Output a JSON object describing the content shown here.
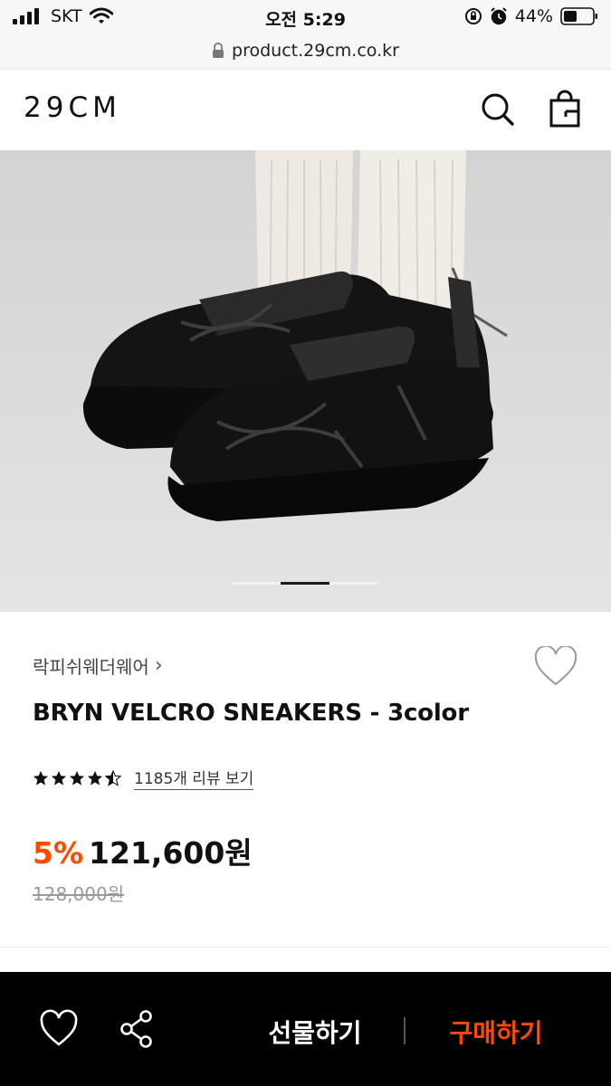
{
  "status_bar": {
    "carrier": "SKT",
    "time": "오전 5:29",
    "battery": "44%"
  },
  "browser": {
    "url": "product.29cm.co.kr"
  },
  "header": {
    "logo": "29CM"
  },
  "gallery": {
    "image_description_icon": "sneaker-photo",
    "current_page_fraction": 0.33
  },
  "product": {
    "brand": "락피쉬웨더웨어",
    "brand_chevron": "›",
    "title": "BRYN VELCRO SNEAKERS - 3color",
    "rating_stars": 4.5,
    "review_link": "1185개 리뷰 보기",
    "discount": "5%",
    "price": "121,600원",
    "original_price": "128,000원"
  },
  "bottom_bar": {
    "gift_label": "선물하기",
    "buy_label": "구매하기"
  },
  "colors": {
    "accent": "#ff4800",
    "bottom_bar_bg": "#000000"
  }
}
